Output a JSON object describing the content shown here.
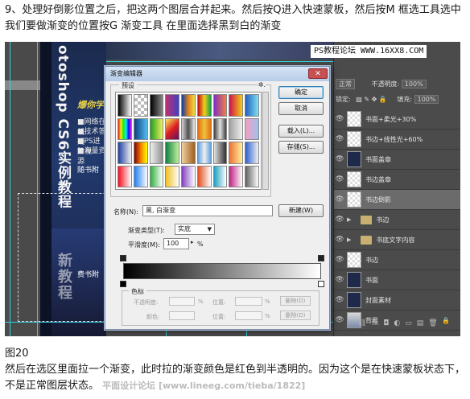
{
  "text": {
    "top_paragraph": "9、处理好倒影位置之后，把这两个图层合并起来。然后按Q进入快速蒙板，然后按M 框选工具选中我们要做渐变的位置按G 渐变工具 在里面选择黑到白的渐变",
    "figure_label": "图20",
    "bottom_paragraph": "然后在选区里面拉一个渐变，此时拉的渐变颜色是红色到半透明的。因为这个是在快速蒙板状态下，不是正常图层状态。",
    "bottom_watermark": "平面设计论坛 [www.lineeg.com/tieba/1822]"
  },
  "watermark": "PS教程论坛 WWW.16XX8.COM",
  "book": {
    "title": "otoshop CS6实例教程",
    "slogan": "爆你学",
    "bullets": [
      "■网络在线",
      "■技术答疑",
      "■PS进阶视",
      "■海量资源"
    ],
    "publisher": "随书附",
    "publisher2": "费书附",
    "reflection_text": "新教程"
  },
  "dialog": {
    "title": "渐变编辑器",
    "close": "✕",
    "presets_label": "预设",
    "gear": "✲.",
    "buttons": {
      "ok": "确定",
      "cancel": "取消",
      "load": "载入(L)...",
      "save": "存储(S)...",
      "new": "新建(W)"
    },
    "name_label": "名称(N):",
    "name_value": "黑, 白渐变",
    "type_label": "渐变类型(T):",
    "type_value": "实底",
    "smoothness_label": "平滑度(M):",
    "smoothness_value": "100",
    "smoothness_unit": "%",
    "color_group_label": "色标",
    "opacity_label": "不透明度:",
    "opacity_unit": "%",
    "location_label": "位置:",
    "location_unit": "%",
    "delete_label": "删除(D)",
    "color_label": "颜色:",
    "location2_label": "位置:",
    "location2_unit": "%",
    "delete2_label": "删除(D)",
    "gradient": {
      "from": "#000000",
      "to": "#ffffff"
    }
  },
  "layers_panel": {
    "blend_mode": "正常",
    "opacity_label": "不透明度:",
    "opacity_value": "100%",
    "lock_label": "锁定:",
    "fill_label": "填充:",
    "fill_value": "100%",
    "layers": [
      {
        "name": "书面+柔光+30%",
        "thumb": "checker",
        "selected": false
      },
      {
        "name": "书边+线性光+60%",
        "thumb": "checker",
        "selected": false
      },
      {
        "name": "书面盖章",
        "thumb": "dark",
        "selected": false
      },
      {
        "name": "书边盖章",
        "thumb": "checker",
        "selected": false
      },
      {
        "name": "书边倒影",
        "thumb": "checker",
        "selected": true
      },
      {
        "name": "书边",
        "thumb": "folder",
        "selected": false
      },
      {
        "name": "书底文字内容",
        "thumb": "folder",
        "selected": false
      },
      {
        "name": "书边",
        "thumb": "checker",
        "selected": false
      },
      {
        "name": "书面",
        "thumb": "dark",
        "selected": false
      },
      {
        "name": "封面素材",
        "thumb": "dark",
        "selected": false
      },
      {
        "name": "背景",
        "thumb": "img",
        "selected": false
      }
    ],
    "bottom_icons": [
      "⛓",
      "fx",
      "◘",
      "◐",
      "▭",
      "▤",
      "🗑"
    ]
  },
  "preset_swatches": [
    "linear-gradient(90deg,#000,#fff)",
    "repeating-conic-gradient(#bbb 0 25%,#fff 0 50%) 0 0/8px 8px",
    "linear-gradient(90deg,#000,#888)",
    "linear-gradient(90deg,#c03070,#4040c0)",
    "linear-gradient(90deg,#1040a0,#e08020,#f0e040)",
    "linear-gradient(90deg,#c01010,#f0d020,#10a040)",
    "linear-gradient(90deg,#8030c0,#f08040)",
    "linear-gradient(90deg,#d01050,#f0d010)",
    "linear-gradient(90deg,#2060c0,#80e0f0)",
    "linear-gradient(90deg,#f01010,#f0f010,#10f010,#10f0f0,#1010f0,#f010f0)",
    "linear-gradient(90deg,#104080,#50c0f0)",
    "linear-gradient(90deg,#20a020,#f0f060)",
    "linear-gradient(135deg,#f0f060,#e02020,#601060)",
    "linear-gradient(90deg,#d0d0d0,#505050,#f0f0f0)",
    "linear-gradient(90deg,#e07010,#f0c040,#e07010)",
    "linear-gradient(90deg,#404040,#e0e0e0,#404040)",
    "linear-gradient(90deg,#a0a0a0,#f0f0f0)",
    "linear-gradient(90deg,#f0a0c0,#a0c0f0)",
    "linear-gradient(90deg,#2040a0,#f0f0f0)",
    "linear-gradient(90deg,#800000,#f08000,#ffff00)",
    "linear-gradient(90deg,#f0f0f0,#909090)",
    "linear-gradient(90deg,#108040,#c0f0a0)",
    "linear-gradient(90deg,#f0d0a0,#a06020)",
    "linear-gradient(90deg,#60a0e0,#f0f0f0,#60a0e0)",
    "linear-gradient(90deg,#e0e0e0,#303030)",
    "linear-gradient(90deg,#f07030,#fff0a0)",
    "linear-gradient(90deg,#3060d0,#f0f0f0)",
    "linear-gradient(90deg,#f01020,#fff)",
    "linear-gradient(90deg,#2080f0,#fff)",
    "linear-gradient(90deg,#30b040,#fff)",
    "linear-gradient(90deg,#f0c020,#fff)",
    "linear-gradient(90deg,#8040c0,#fff)",
    "linear-gradient(90deg,#e05020,#fff)",
    "linear-gradient(90deg,#20a0c0,#fff)",
    "linear-gradient(90deg,#c02080,#fff)",
    "linear-gradient(90deg,#606060,#fff)"
  ],
  "colors": {
    "guide": "#36d0e0",
    "dialog_bg": "#efefef",
    "layers_bg": "#4b4b4b"
  }
}
